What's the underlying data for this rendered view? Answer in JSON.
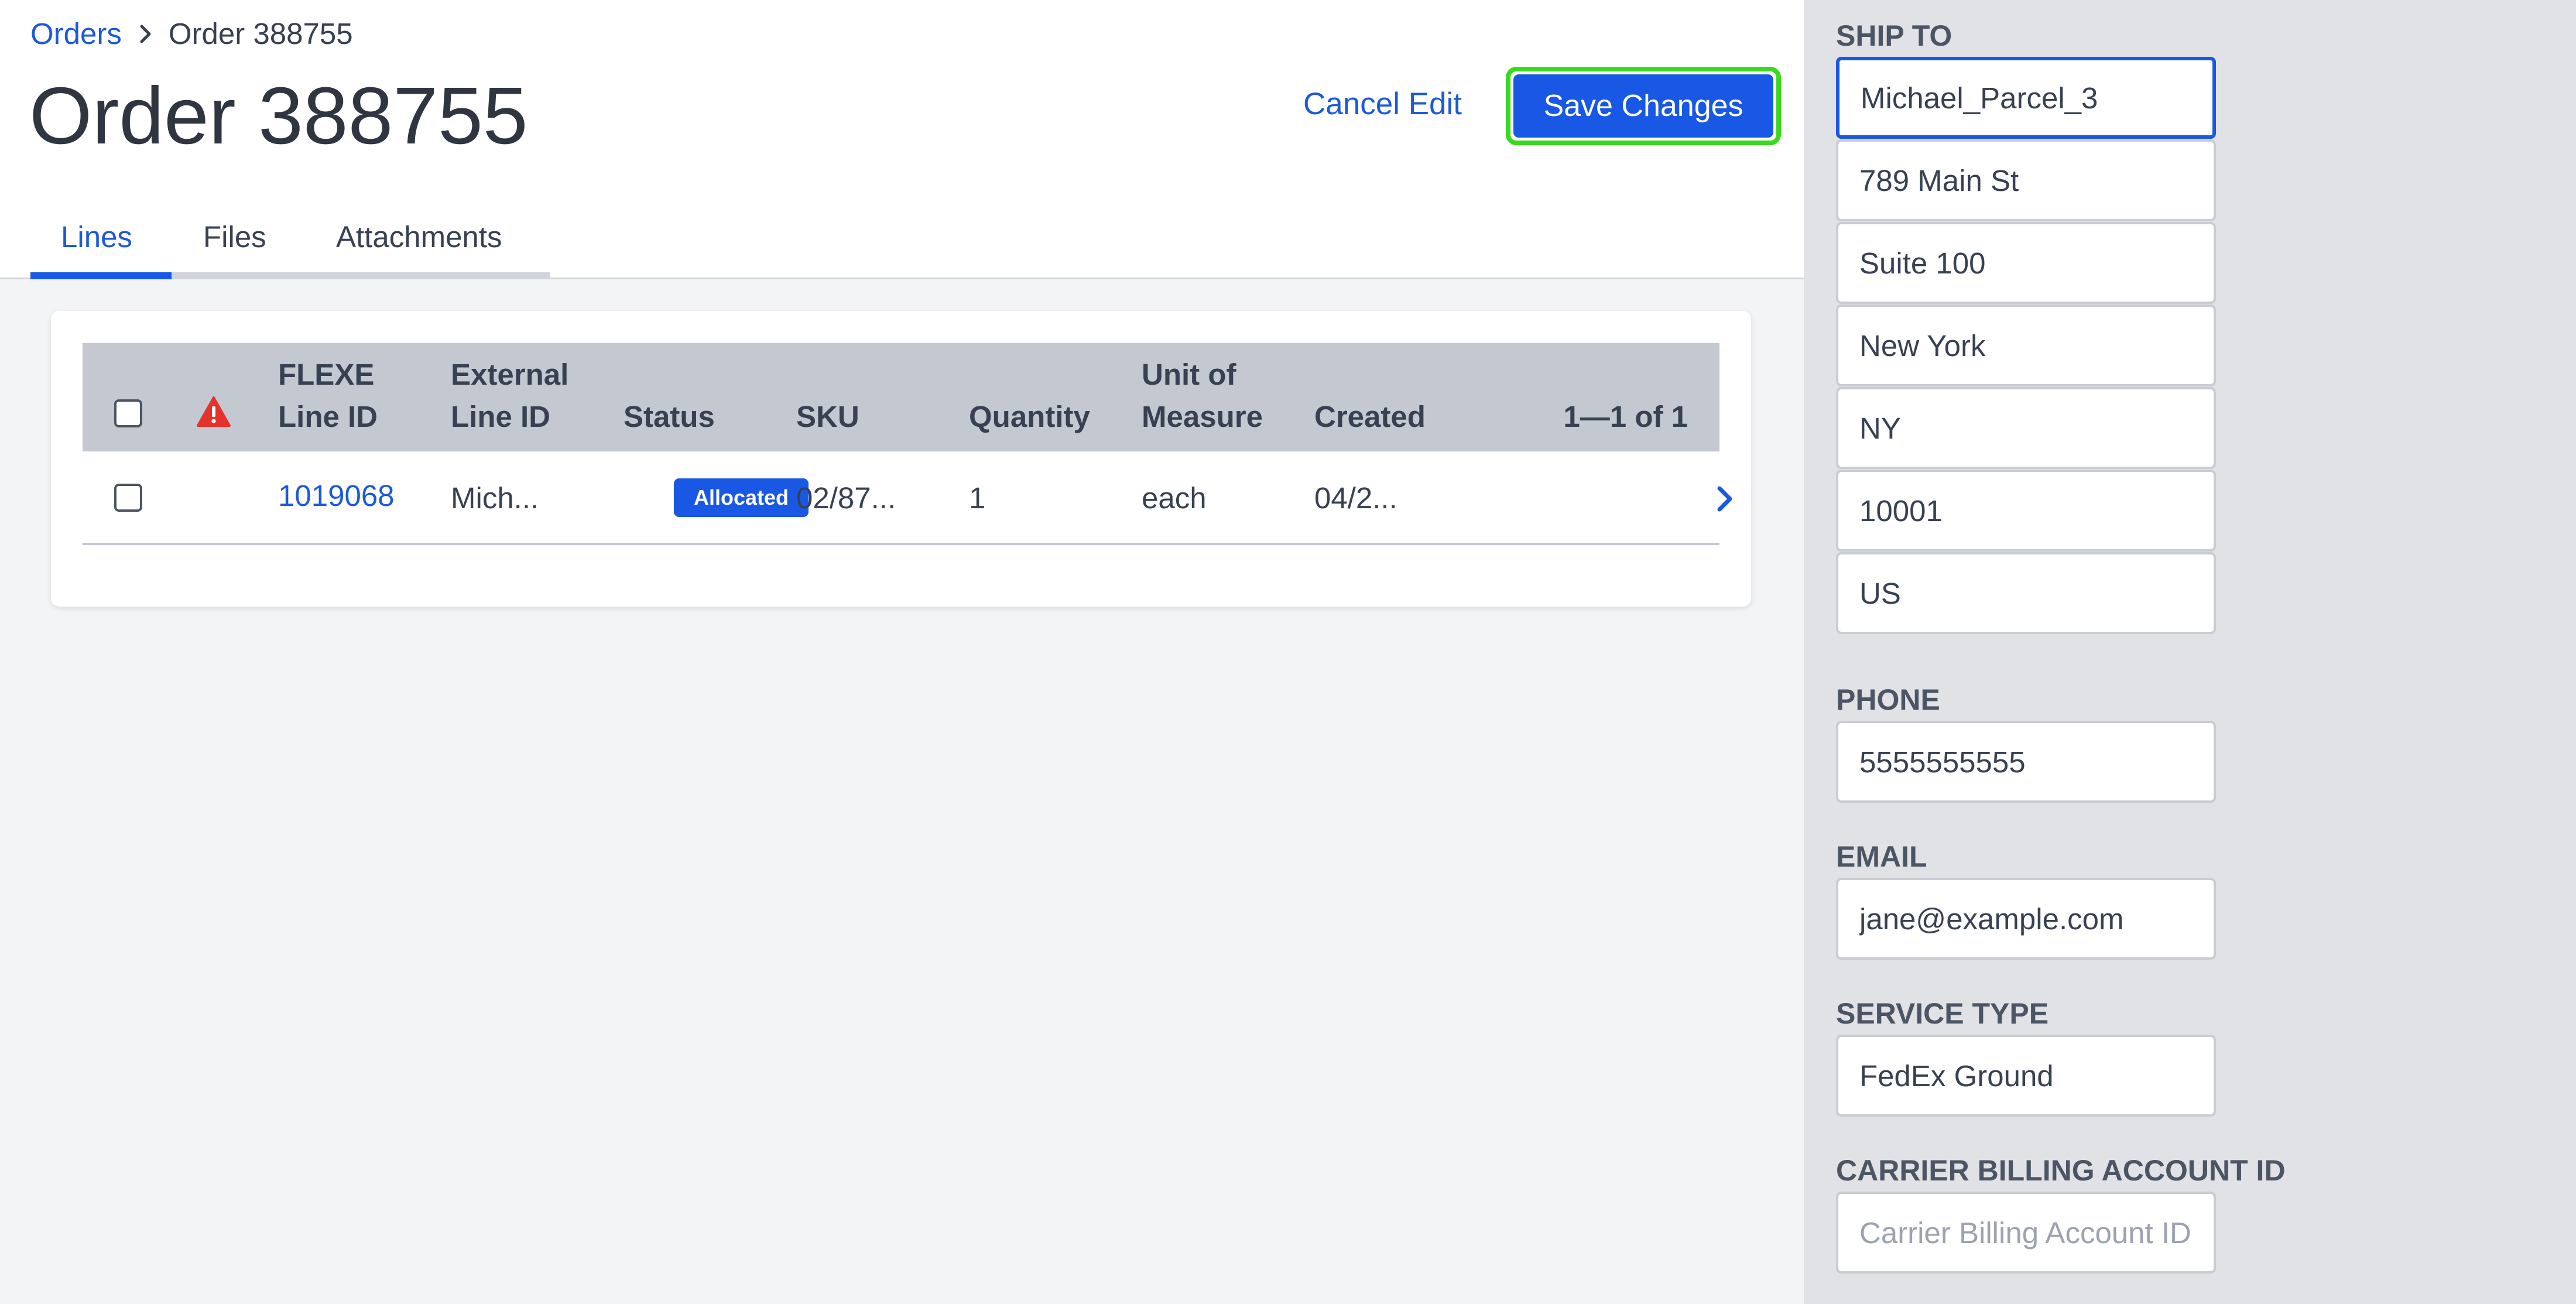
{
  "breadcrumb": {
    "parent": "Orders",
    "current": "Order 388755"
  },
  "page": {
    "title": "Order 388755"
  },
  "actions": {
    "cancel_label": "Cancel Edit",
    "save_label": "Save Changes"
  },
  "tabs": [
    {
      "label": "Lines",
      "active": true
    },
    {
      "label": "Files",
      "active": false
    },
    {
      "label": "Attachments",
      "active": false
    }
  ],
  "table": {
    "headers": {
      "flexe_line_id": [
        "FLEXE",
        "Line ID"
      ],
      "external_line_id": [
        "External",
        "Line ID"
      ],
      "status": "Status",
      "sku": "SKU",
      "quantity": "Quantity",
      "unit_of_measure": [
        "Unit of",
        "Measure"
      ],
      "created": "Created",
      "pagination": "1—1 of 1"
    },
    "rows": [
      {
        "flexe_line_id": "1019068",
        "external_line_id": "Mich...",
        "status": "Allocated",
        "sku": "02/87...",
        "quantity": "1",
        "unit_of_measure": "each",
        "created": "04/2..."
      }
    ]
  },
  "ship_to": {
    "label": "SHIP TO",
    "name": "Michael_Parcel_3",
    "address1": "789 Main St",
    "address2": "Suite 100",
    "city": "New York",
    "state": "NY",
    "zip": "10001",
    "country": "US"
  },
  "phone": {
    "label": "PHONE",
    "value": "5555555555"
  },
  "email": {
    "label": "EMAIL",
    "value": "jane@example.com"
  },
  "service_type": {
    "label": "SERVICE TYPE",
    "value": "FedEx Ground"
  },
  "carrier_billing": {
    "label": "CARRIER BILLING ACCOUNT ID",
    "placeholder": "Carrier Billing Account ID"
  },
  "colors": {
    "accent": "#1958e5",
    "link": "#1d5ad6",
    "focus_outline": "#39d91f",
    "warning": "#e5322d"
  }
}
